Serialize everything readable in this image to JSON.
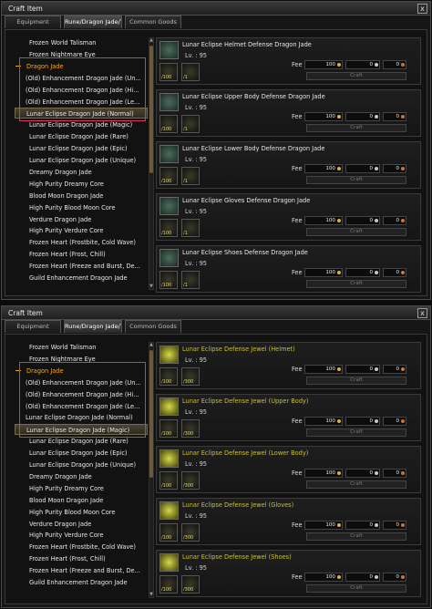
{
  "windows": [
    {
      "title": "Craft Item",
      "close": "x",
      "tabs": [
        "Equipment",
        "Rune/Dragon Jade/Ta...",
        "Common Goods"
      ],
      "tree": [
        {
          "label": "Frozen World Talisman",
          "kind": "item"
        },
        {
          "label": "Frozen Nightmare Eye",
          "kind": "item"
        },
        {
          "label": "Dragon Jade",
          "kind": "category"
        },
        {
          "label": "(Old) Enhancement Dragon Jade (Un...",
          "kind": "child"
        },
        {
          "label": "(Old) Enhancement Dragon Jade (Hi...",
          "kind": "child"
        },
        {
          "label": "(Old) Enhancement Dragon Jade (Le...",
          "kind": "child"
        },
        {
          "label": "Lunar Eclipse Dragon Jade (Normal)",
          "kind": "selected"
        },
        {
          "label": "Lunar Eclipse Dragon Jade (Magic)",
          "kind": "item"
        },
        {
          "label": "Lunar Eclipse Dragon Jade (Rare)",
          "kind": "item"
        },
        {
          "label": "Lunar Eclipse Dragon Jade (Epic)",
          "kind": "item"
        },
        {
          "label": "Lunar Eclipse Dragon Jade (Unique)",
          "kind": "item"
        },
        {
          "label": "Dreamy Dragon Jade",
          "kind": "item"
        },
        {
          "label": "High Purity Dreamy Core",
          "kind": "item"
        },
        {
          "label": "Blood Moon Dragon Jade",
          "kind": "item"
        },
        {
          "label": "High Purity Blood Moon Core",
          "kind": "item"
        },
        {
          "label": "Verdure Dragon Jade",
          "kind": "item"
        },
        {
          "label": "High Purity Verdure Core",
          "kind": "item"
        },
        {
          "label": "Frozen Heart (Frostbite, Cold Wave)",
          "kind": "item"
        },
        {
          "label": "Frozen Heart (Frost, Chill)",
          "kind": "item"
        },
        {
          "label": "Frozen Heart (Freeze and Burst, De...",
          "kind": "item"
        },
        {
          "label": "Guild Enhancement Dragon Jade",
          "kind": "item"
        }
      ],
      "recipes": [
        {
          "name": "Lunar Eclipse Helmet Defense Dragon Jade",
          "level": "Lv. : 95",
          "mats": [
            "/100",
            "/1"
          ]
        },
        {
          "name": "Lunar Eclipse Upper Body Defense Dragon Jade",
          "level": "Lv. : 95",
          "mats": [
            "/100",
            "/1"
          ]
        },
        {
          "name": "Lunar Eclipse Lower Body Defense Dragon Jade",
          "level": "Lv. : 95",
          "mats": [
            "/100",
            "/1"
          ]
        },
        {
          "name": "Lunar Eclipse Gloves Defense Dragon Jade",
          "level": "Lv. : 95",
          "mats": [
            "/100",
            "/1"
          ]
        },
        {
          "name": "Lunar Eclipse Shoes Defense Dragon Jade",
          "level": "Lv. : 95",
          "mats": [
            "/100",
            "/1"
          ]
        }
      ],
      "fee": {
        "label": "Fee",
        "gold": "100",
        "silver": "0",
        "copper": "0"
      },
      "craft_label": "Craft",
      "highlight": {
        "from": 2,
        "to": 6
      }
    },
    {
      "title": "Craft Item",
      "close": "x",
      "tabs": [
        "Equipment",
        "Rune/Dragon Jade/Ta...",
        "Common Goods"
      ],
      "tree": [
        {
          "label": "Frozen World Talisman",
          "kind": "item"
        },
        {
          "label": "Frozen Nightmare Eye",
          "kind": "item"
        },
        {
          "label": "Dragon Jade",
          "kind": "category"
        },
        {
          "label": "(Old) Enhancement Dragon Jade (Un...",
          "kind": "child"
        },
        {
          "label": "(Old) Enhancement Dragon Jade (Hi...",
          "kind": "child"
        },
        {
          "label": "(Old) Enhancement Dragon Jade (Le...",
          "kind": "child"
        },
        {
          "label": "Lunar Eclipse Dragon Jade (Normal)",
          "kind": "child"
        },
        {
          "label": "Lunar Eclipse Dragon Jade (Magic)",
          "kind": "selected"
        },
        {
          "label": "Lunar Eclipse Dragon Jade (Rare)",
          "kind": "item"
        },
        {
          "label": "Lunar Eclipse Dragon Jade (Epic)",
          "kind": "item"
        },
        {
          "label": "Lunar Eclipse Dragon Jade (Unique)",
          "kind": "item"
        },
        {
          "label": "Dreamy Dragon Jade",
          "kind": "item"
        },
        {
          "label": "High Purity Dreamy Core",
          "kind": "item"
        },
        {
          "label": "Blood Moon Dragon Jade",
          "kind": "item"
        },
        {
          "label": "High Purity Blood Moon Core",
          "kind": "item"
        },
        {
          "label": "Verdure Dragon Jade",
          "kind": "item"
        },
        {
          "label": "High Purity Verdure Core",
          "kind": "item"
        },
        {
          "label": "Frozen Heart (Frostbite, Cold Wave)",
          "kind": "item"
        },
        {
          "label": "Frozen Heart (Frost, Chill)",
          "kind": "item"
        },
        {
          "label": "Frozen Heart (Freeze and Burst, De...",
          "kind": "item"
        },
        {
          "label": "Guild Enhancement Dragon Jade",
          "kind": "item"
        }
      ],
      "recipes": [
        {
          "name": "Lunar Eclipse Defense Jewel (Helmet)",
          "level": "Lv. : 95",
          "mats": [
            "/100",
            "/300"
          ]
        },
        {
          "name": "Lunar Eclipse Defense Jewel (Upper Body)",
          "level": "Lv. : 95",
          "mats": [
            "/100",
            "/300"
          ]
        },
        {
          "name": "Lunar Eclipse Defense Jewel (Lower Body)",
          "level": "Lv. : 95",
          "mats": [
            "/100",
            "/300"
          ]
        },
        {
          "name": "Lunar Eclipse Defense Jewel (Gloves)",
          "level": "Lv. : 95",
          "mats": [
            "/100",
            "/300"
          ]
        },
        {
          "name": "Lunar Eclipse Defense Jewel (Shoes)",
          "level": "Lv. : 95",
          "mats": [
            "/100",
            "/300"
          ]
        }
      ],
      "fee": {
        "label": "Fee",
        "gold": "100",
        "silver": "0",
        "copper": "0"
      },
      "craft_label": "Craft",
      "highlight": {
        "from": 2,
        "to": 7
      }
    }
  ],
  "colors": {
    "highlight_border": "#e0316a",
    "category": "#f5a623",
    "jewel_name": "#c9c034",
    "gold_coin": "#e0b030",
    "silver_coin": "#c8c8c8",
    "copper_coin": "#c9743a"
  },
  "icons": {
    "close": "close-icon",
    "item": "dragon-jade-icon",
    "jewel": "defense-jewel-icon",
    "material": "material-icon",
    "coin": "coin-icon"
  }
}
